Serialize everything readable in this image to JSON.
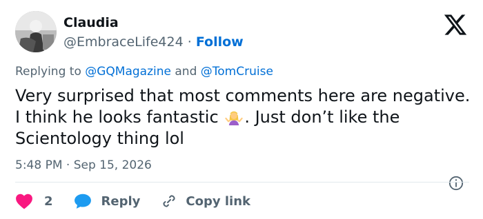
{
  "author": {
    "display_name": "Claudia",
    "handle": "@EmbraceLife424",
    "separator": "·",
    "follow_label": "Follow"
  },
  "reply_context": {
    "prefix": "Replying to",
    "mention_1": "@GQMagazine",
    "conjunction": "and",
    "mention_2": "@TomCruise"
  },
  "tweet": {
    "text_before_emoji": "Very surprised that most comments here are negative. I think he looks fantastic",
    "emoji": "woman-shrugging",
    "text_after_emoji": ". Just don’t like the Scientology thing lol",
    "timestamp": "5:48 PM · Sep 15, 2026"
  },
  "actions": {
    "like_count": "2",
    "reply_label": "Reply",
    "copy_label": "Copy link"
  },
  "colors": {
    "text": "#0f1419",
    "secondary": "#536471",
    "link": "#006fd6",
    "like": "#f91880",
    "reply": "#1d9bf0",
    "divider": "#e1e8ed"
  },
  "icons": [
    "x-logo-icon",
    "heart-icon",
    "reply-bubble-icon",
    "link-icon",
    "info-icon"
  ]
}
